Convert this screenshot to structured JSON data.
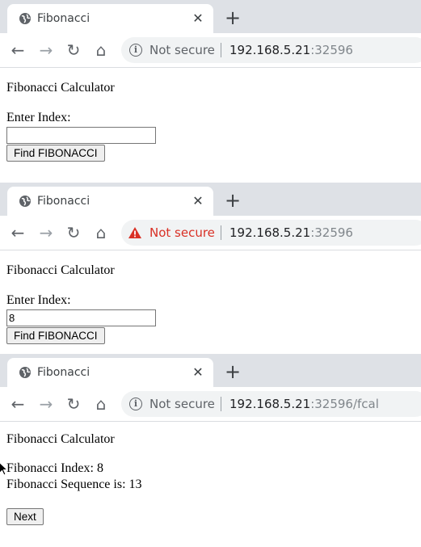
{
  "windows": [
    {
      "tab_title": "Fibonacci",
      "security_text": "Not secure",
      "security_warning": false,
      "url_host": "192.168.5.21",
      "url_rest": ":32596",
      "heading": "Fibonacci Calculator",
      "index_label": "Enter Index:",
      "index_value": "",
      "find_button": "Find FIBONACCI"
    },
    {
      "tab_title": "Fibonacci",
      "security_text": "Not secure",
      "security_warning": true,
      "url_host": "192.168.5.21",
      "url_rest": ":32596",
      "heading": "Fibonacci Calculator",
      "index_label": "Enter Index:",
      "index_value": "8",
      "find_button": "Find FIBONACCI"
    },
    {
      "tab_title": "Fibonacci",
      "security_text": "Not secure",
      "security_warning": false,
      "url_host": "192.168.5.21",
      "url_rest": ":32596/fcal",
      "heading": "Fibonacci Calculator",
      "result_index": "Fibonacci Index: 8",
      "result_sequence": "Fibonacci Sequence is: 13",
      "next_button": "Next"
    }
  ],
  "colors": {
    "tabstrip": "#dee1e6",
    "warning": "#d93025",
    "omnibox": "#f1f3f4"
  }
}
